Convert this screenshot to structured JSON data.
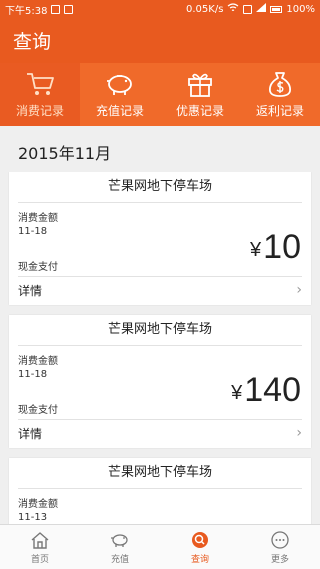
{
  "status_bar": {
    "time": "下午5:38",
    "speed": "0.05K/s",
    "battery": "100%"
  },
  "header": {
    "title": "查询"
  },
  "tabs": [
    {
      "label": "消费记录",
      "icon": "cart-icon",
      "active": true
    },
    {
      "label": "充值记录",
      "icon": "piggy-bank-icon",
      "active": false
    },
    {
      "label": "优惠记录",
      "icon": "gift-icon",
      "active": false
    },
    {
      "label": "返利记录",
      "icon": "money-bag-icon",
      "active": false
    }
  ],
  "month_label": "2015年11月",
  "records": [
    {
      "place": "芒果网地下停车场",
      "type_label": "消费金额",
      "date": "11-18",
      "payment": "现金支付",
      "currency": "¥",
      "amount": "10",
      "detail_label": "详情"
    },
    {
      "place": "芒果网地下停车场",
      "type_label": "消费金额",
      "date": "11-18",
      "payment": "现金支付",
      "currency": "¥",
      "amount": "140",
      "detail_label": "详情"
    },
    {
      "place": "芒果网地下停车场",
      "type_label": "消费金额",
      "date": "11-13",
      "payment": "",
      "currency": "",
      "amount": "",
      "detail_label": ""
    }
  ],
  "bottom_nav": [
    {
      "label": "首页",
      "icon": "home-icon",
      "active": false
    },
    {
      "label": "充值",
      "icon": "piggy-bank-icon",
      "active": false
    },
    {
      "label": "查询",
      "icon": "search-icon",
      "active": true
    },
    {
      "label": "更多",
      "icon": "more-icon",
      "active": false
    }
  ],
  "colors": {
    "primary": "#e85a1f",
    "tab_bar": "#f06a2a",
    "active_tab_text": "#ffe0c6"
  }
}
